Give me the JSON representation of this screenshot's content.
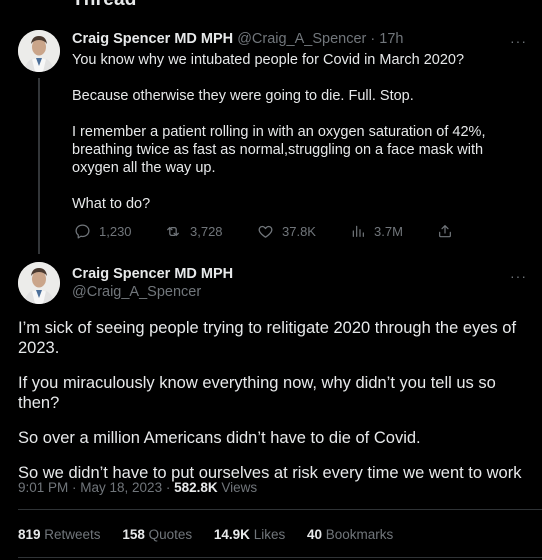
{
  "header": {
    "title": "Thread"
  },
  "tweet1": {
    "name": "Craig Spencer MD MPH",
    "handle": "@Craig_A_Spencer",
    "separator": "·",
    "time": "17h",
    "paragraphs": [
      "You know why we intubated people for Covid in March 2020?",
      "Because otherwise they were going to die. Full. Stop.",
      "I remember a patient rolling in with an oxygen saturation of 42%, breathing twice as fast as normal,struggling on a face mask with oxygen all the way up.",
      "What to do?"
    ],
    "actions": {
      "replies": "1,230",
      "retweets": "3,728",
      "likes": "37.8K",
      "views": "3.7M"
    }
  },
  "tweet2": {
    "name": "Craig Spencer MD MPH",
    "handle": "@Craig_A_Spencer",
    "paragraphs": [
      "I’m sick of seeing people trying to relitigate 2020 through the eyes of 2023.",
      "If you miraculously know everything now, why didn’t you tell us so then?",
      "So over a million Americans didn’t have to die of Covid.",
      "So we didn’t have to put ourselves at risk every time we went to work"
    ],
    "timestamp": "9:01 PM · May 18, 2023 · ",
    "views_count": "582.8K",
    "views_label": " Views",
    "stats": {
      "retweets_count": "819",
      "retweets_label": " Retweets",
      "quotes_count": "158",
      "quotes_label": " Quotes",
      "likes_count": "14.9K",
      "likes_label": " Likes",
      "bookmarks_count": "40",
      "bookmarks_label": " Bookmarks"
    }
  },
  "icons": {
    "more": "···"
  },
  "colors": {
    "background": "#000000",
    "text": "#e7e9ea",
    "muted": "#71767b",
    "divider": "#2f3336"
  }
}
